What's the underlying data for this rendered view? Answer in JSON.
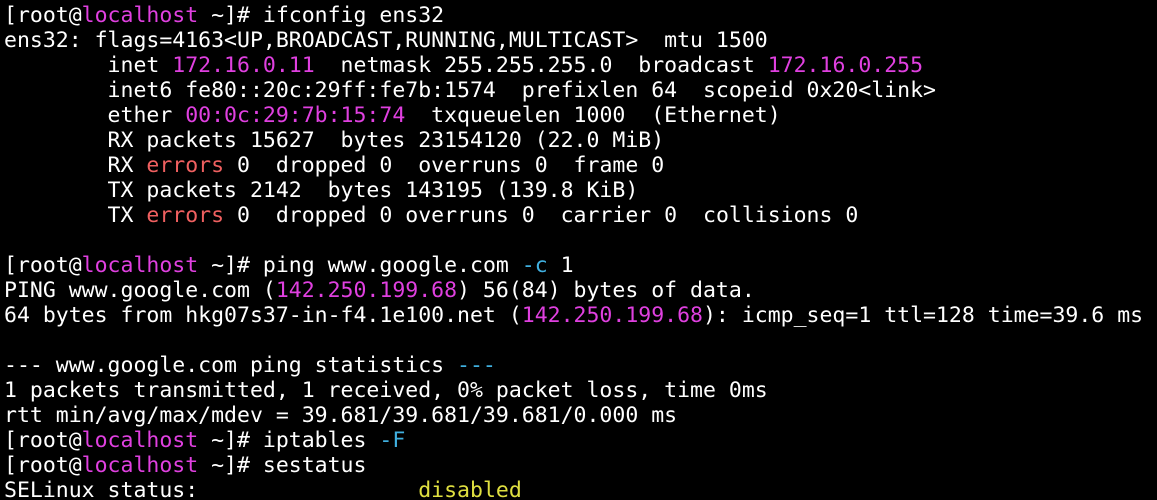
{
  "colors": {
    "background": "#000000",
    "foreground": "#ffffff",
    "hostname": "#e040e0",
    "ip_address": "#e040e0",
    "error_word": "#f06060",
    "cli_flag": "#40b0e0",
    "status_value": "#e0e040"
  },
  "terminal": {
    "lines": [
      [
        {
          "t": "[root@",
          "c": ""
        },
        {
          "t": "localhost",
          "c": "host"
        },
        {
          "t": " ~]# ifconfig ens32",
          "c": ""
        }
      ],
      [
        {
          "t": "ens32: flags=4163<UP,BROADCAST,RUNNING,MULTICAST>  mtu 1500",
          "c": ""
        }
      ],
      [
        {
          "t": "        inet ",
          "c": ""
        },
        {
          "t": "172.16.0.11",
          "c": "ip"
        },
        {
          "t": "  netmask 255.255.255.0  broadcast ",
          "c": ""
        },
        {
          "t": "172.16.0.255",
          "c": "ip"
        }
      ],
      [
        {
          "t": "        inet6 fe80::20c:29ff:fe7b:1574  prefixlen 64  scopeid 0x20<link>",
          "c": ""
        }
      ],
      [
        {
          "t": "        ether ",
          "c": ""
        },
        {
          "t": "00:0c:29:7b:15:74",
          "c": "ip"
        },
        {
          "t": "  txqueuelen 1000  (Ethernet)",
          "c": ""
        }
      ],
      [
        {
          "t": "        RX packets 15627  bytes 23154120 (22.0 MiB)",
          "c": ""
        }
      ],
      [
        {
          "t": "        RX ",
          "c": ""
        },
        {
          "t": "errors",
          "c": "err"
        },
        {
          "t": " 0  dropped 0  overruns 0  frame 0",
          "c": ""
        }
      ],
      [
        {
          "t": "        TX packets 2142  bytes 143195 (139.8 KiB)",
          "c": ""
        }
      ],
      [
        {
          "t": "        TX ",
          "c": ""
        },
        {
          "t": "errors",
          "c": "err"
        },
        {
          "t": " 0  dropped 0 overruns 0  carrier 0  collisions 0",
          "c": ""
        }
      ],
      [
        {
          "t": "",
          "c": ""
        }
      ],
      [
        {
          "t": "[root@",
          "c": ""
        },
        {
          "t": "localhost",
          "c": "host"
        },
        {
          "t": " ~]# ping www.google.com ",
          "c": ""
        },
        {
          "t": "-c",
          "c": "flag"
        },
        {
          "t": " 1",
          "c": ""
        }
      ],
      [
        {
          "t": "PING www.google.com (",
          "c": ""
        },
        {
          "t": "142.250.199.68",
          "c": "ip"
        },
        {
          "t": ") 56(84) bytes of data.",
          "c": ""
        }
      ],
      [
        {
          "t": "64 bytes from hkg07s37-in-f4.1e100.net (",
          "c": ""
        },
        {
          "t": "142.250.199.68",
          "c": "ip"
        },
        {
          "t": "): icmp_seq=1 ttl=128 time=39.6 ms",
          "c": ""
        }
      ],
      [
        {
          "t": "",
          "c": ""
        }
      ],
      [
        {
          "t": "--- www.google.com ping statistics ",
          "c": ""
        },
        {
          "t": "---",
          "c": "flag"
        }
      ],
      [
        {
          "t": "1 packets transmitted, 1 received, 0% packet loss, time 0ms",
          "c": ""
        }
      ],
      [
        {
          "t": "rtt min/avg/max/mdev = 39.681/39.681/39.681/0.000 ms",
          "c": ""
        }
      ],
      [
        {
          "t": "[root@",
          "c": ""
        },
        {
          "t": "localhost",
          "c": "host"
        },
        {
          "t": " ~]# iptables ",
          "c": ""
        },
        {
          "t": "-F",
          "c": "flag"
        }
      ],
      [
        {
          "t": "[root@",
          "c": ""
        },
        {
          "t": "localhost",
          "c": "host"
        },
        {
          "t": " ~]# sestatus",
          "c": ""
        }
      ],
      [
        {
          "t": "SELinux status:                 ",
          "c": ""
        },
        {
          "t": "disabled",
          "c": "ok"
        }
      ]
    ]
  }
}
